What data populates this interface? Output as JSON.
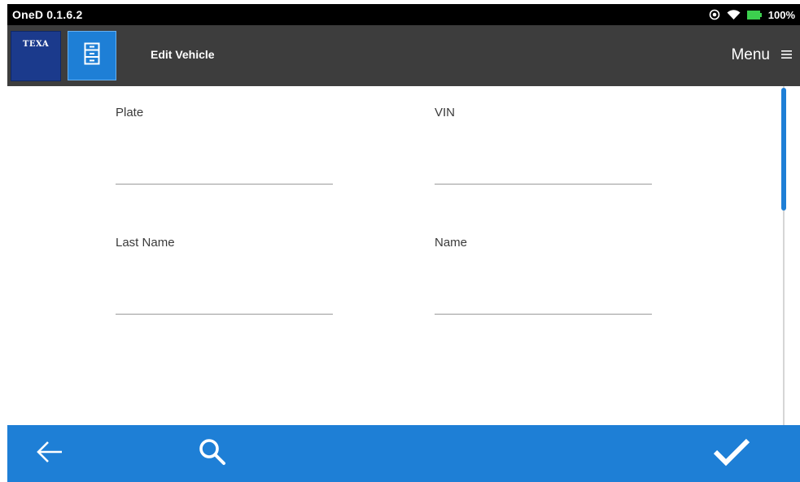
{
  "status_bar": {
    "app_version": "OneD 0.1.6.2",
    "battery_percent": "100%",
    "icons": [
      "location-icon",
      "wifi-icon",
      "battery-icon"
    ]
  },
  "header": {
    "brand": "TEXA",
    "title": "Edit Vehicle",
    "menu_label": "Menu",
    "icons": [
      "archive-icon",
      "hamburger-icon"
    ]
  },
  "form": {
    "plate": {
      "label": "Plate",
      "value": ""
    },
    "vin": {
      "label": "VIN",
      "value": ""
    },
    "last_name": {
      "label": "Last Name",
      "value": ""
    },
    "name": {
      "label": "Name",
      "value": ""
    }
  },
  "bottom_bar": {
    "icons": [
      "back-arrow-icon",
      "search-icon",
      "checkmark-icon"
    ]
  },
  "colors": {
    "accent": "#1e7fd6",
    "header_bg": "#3d3d3d",
    "status_bg": "#000000",
    "brand_bg": "#1b3a8c"
  }
}
